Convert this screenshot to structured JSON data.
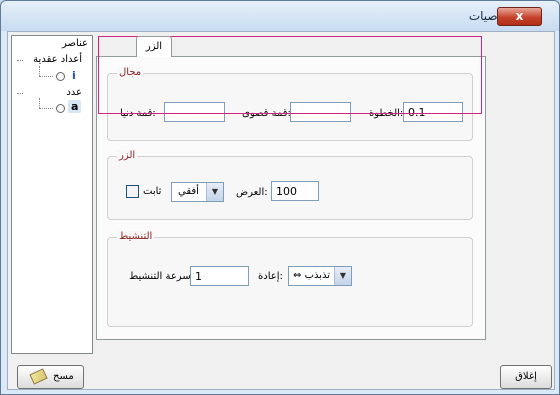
{
  "window": {
    "title": "الخاصيات",
    "close_symbol": "x"
  },
  "tree": {
    "root": "عناصر",
    "groups": [
      {
        "label": "أعداد عقدية",
        "child": "i"
      },
      {
        "label": "عدد",
        "child": "a"
      }
    ]
  },
  "tabs": [
    {
      "label": "الزر"
    }
  ],
  "interval": {
    "title": "مجال",
    "min_label": "قمة دنيا:",
    "min_value": "",
    "max_label": "قمة قصوى:",
    "max_value": "",
    "step_label": "الخطوة:",
    "step_value": "0.1"
  },
  "button": {
    "title": "الزر",
    "fixed_label": "ثابت",
    "fixed_checked": false,
    "orientation_value": "أفقي",
    "width_label": "العرض:",
    "width_value": "100"
  },
  "animation": {
    "title": "التنشيط",
    "repeat_label": "إعادة:",
    "repeat_value": "⇔ تذبذب",
    "speed_label": "سرعة التنشيط:",
    "speed_value": "1"
  },
  "footer": {
    "delete_label": "مسح",
    "close_label": "إغلاق"
  }
}
